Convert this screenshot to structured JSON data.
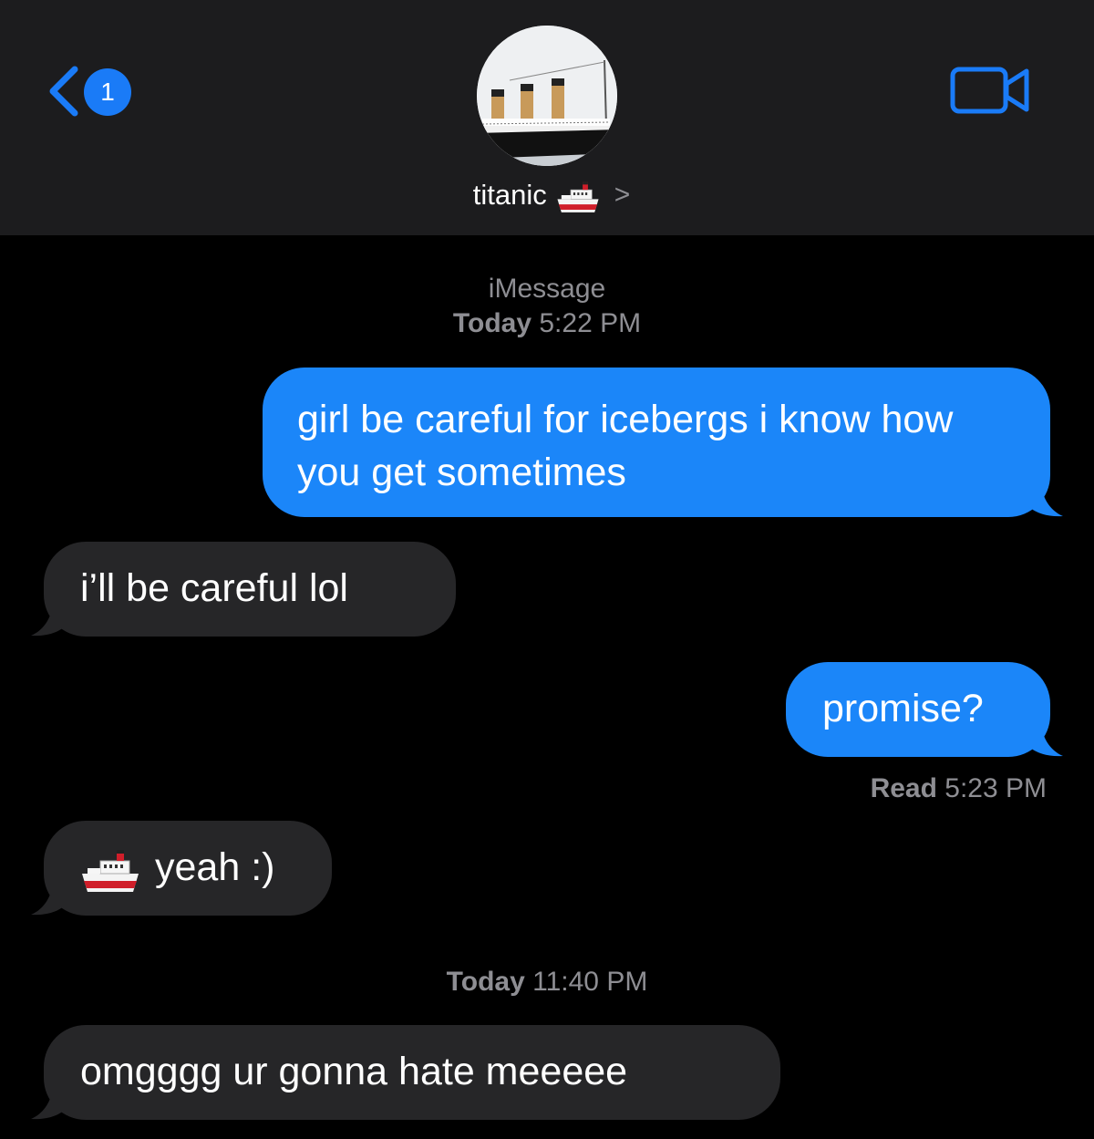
{
  "header": {
    "back_badge_count": "1",
    "contact_name": "titanic",
    "contact_emoji_icon": "ship-icon",
    "chevron_glyph": ">",
    "video_icon": "video-camera-icon",
    "accent_color": "#1a7bf7"
  },
  "conversation": {
    "service_label": "iMessage",
    "first_timestamp": {
      "day": "Today",
      "time": "5:22 PM"
    },
    "messages": [
      {
        "direction": "sent",
        "text": "girl be careful for icebergs i know how you get sometimes"
      },
      {
        "direction": "received",
        "text": "i’ll be careful lol"
      },
      {
        "direction": "sent",
        "text": "promise?"
      },
      {
        "direction": "received",
        "emoji_icon": "ship-icon",
        "text": "yeah :)"
      },
      {
        "direction": "received",
        "text": "omgggg ur gonna hate meeeee"
      }
    ],
    "read_receipt": {
      "label": "Read",
      "time": "5:23 PM"
    },
    "second_timestamp": {
      "day": "Today",
      "time": "11:40 PM"
    }
  },
  "colors": {
    "background": "#000000",
    "header_background": "#1c1c1e",
    "sent_bubble": "#1b86f9",
    "received_bubble": "#262628",
    "meta_text": "#8e8e93"
  }
}
